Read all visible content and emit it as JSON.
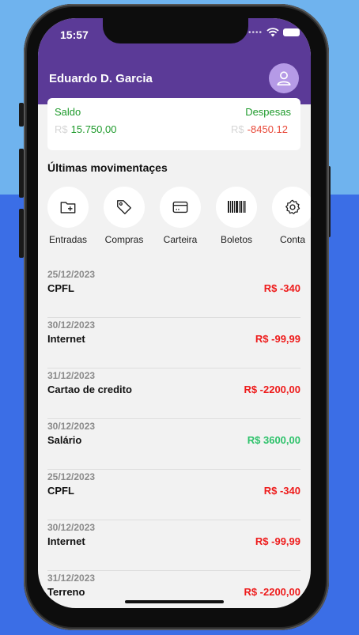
{
  "status_bar": {
    "time": "15:57",
    "signal_icon": "signal-dots-icon",
    "wifi_icon": "wifi-icon",
    "battery_icon": "battery-icon"
  },
  "header": {
    "user_name": "Eduardo D. Garcia",
    "avatar_icon": "user-icon",
    "color": "#5b3a97"
  },
  "balance": {
    "saldo_label": "Saldo",
    "saldo_currency": "R$",
    "saldo_value": "15.750,00",
    "despesas_label": "Despesas",
    "despesas_currency": "R$",
    "despesas_value": "-8450.12"
  },
  "section_title": "Últimas movimentaçes",
  "actions": [
    {
      "label": "Entradas",
      "icon": "folder-add-icon"
    },
    {
      "label": "Compras",
      "icon": "tag-icon"
    },
    {
      "label": "Carteira",
      "icon": "credit-card-icon"
    },
    {
      "label": "Boletos",
      "icon": "barcode-icon"
    },
    {
      "label": "Conta",
      "icon": "gear-icon"
    }
  ],
  "transactions": [
    {
      "date": "25/12/2023",
      "name": "CPFL",
      "amount": "R$ -340",
      "type": "expense"
    },
    {
      "date": "30/12/2023",
      "name": "Internet",
      "amount": "R$ -99,99",
      "type": "expense"
    },
    {
      "date": "31/12/2023",
      "name": "Cartao de credito",
      "amount": "R$ -2200,00",
      "type": "expense"
    },
    {
      "date": "30/12/2023",
      "name": "Salário",
      "amount": "R$ 3600,00",
      "type": "income"
    },
    {
      "date": "25/12/2023",
      "name": "CPFL",
      "amount": "R$ -340",
      "type": "expense"
    },
    {
      "date": "30/12/2023",
      "name": "Internet",
      "amount": "R$ -99,99",
      "type": "expense"
    },
    {
      "date": "31/12/2023",
      "name": "Terreno",
      "amount": "R$ -2200,00",
      "type": "expense"
    }
  ],
  "colors": {
    "income": "#2ec26b",
    "expense": "#ee1b1b",
    "saldo": "#1e9a2b"
  }
}
